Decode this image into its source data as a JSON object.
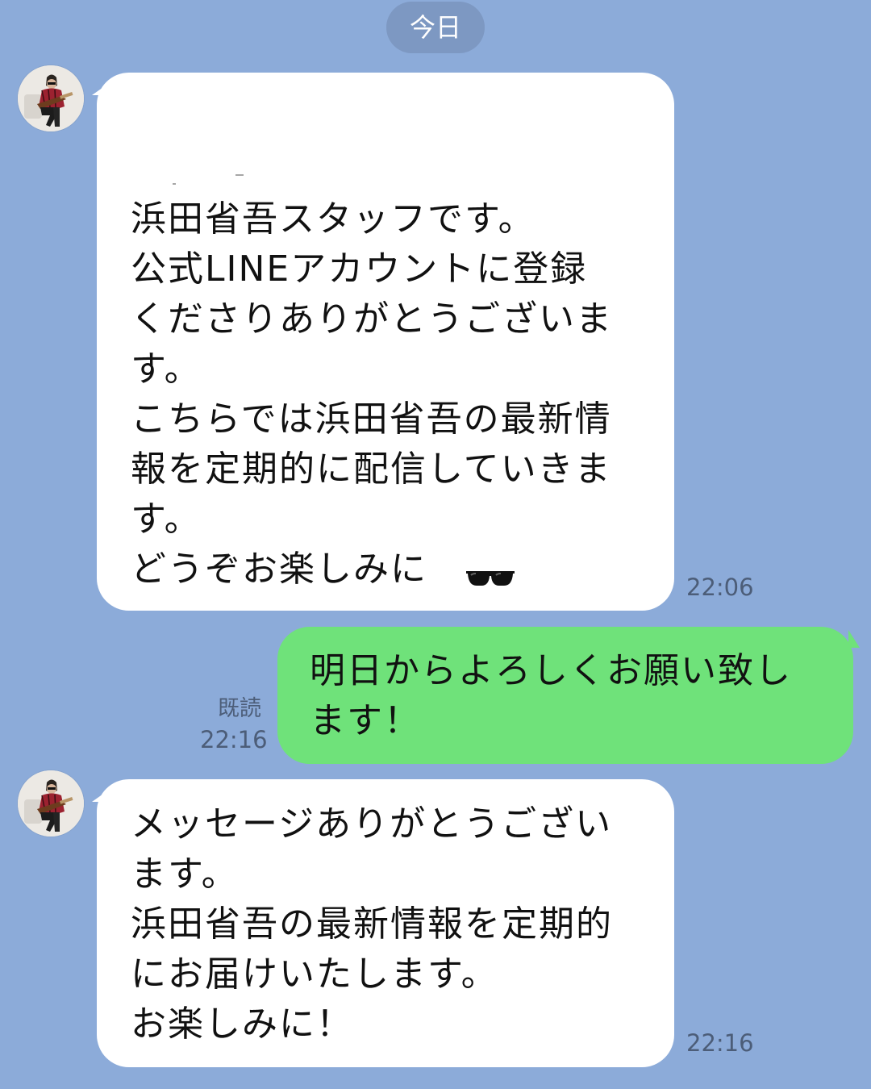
{
  "date_separator": "今日",
  "messages": [
    {
      "side": "received",
      "lines": [
        "浜田省吾スタッフです。",
        "公式LINEアカウントに登録",
        "くださりありがとうございま",
        "す。",
        "こちらでは浜田省吾の最新情",
        "報を定期的に配信していきま",
        "す。",
        "どうぞお楽しみに"
      ],
      "emoji": "sunglasses-icon",
      "time": "22:06"
    },
    {
      "side": "sent",
      "lines": [
        "明日からよろしくお願い致し",
        "ます！"
      ],
      "read_label": "既読",
      "time": "22:16"
    },
    {
      "side": "received",
      "lines": [
        "メッセージありがとうござい",
        "ます。",
        "浜田省吾の最新情報を定期的",
        "にお届けいたします。",
        "お楽しみに！"
      ],
      "time": "22:16"
    }
  ],
  "colors": {
    "background": "#8cabd9",
    "received_bubble": "#ffffff",
    "sent_bubble": "#6fe27a",
    "meta_text": "#4c5d78"
  }
}
